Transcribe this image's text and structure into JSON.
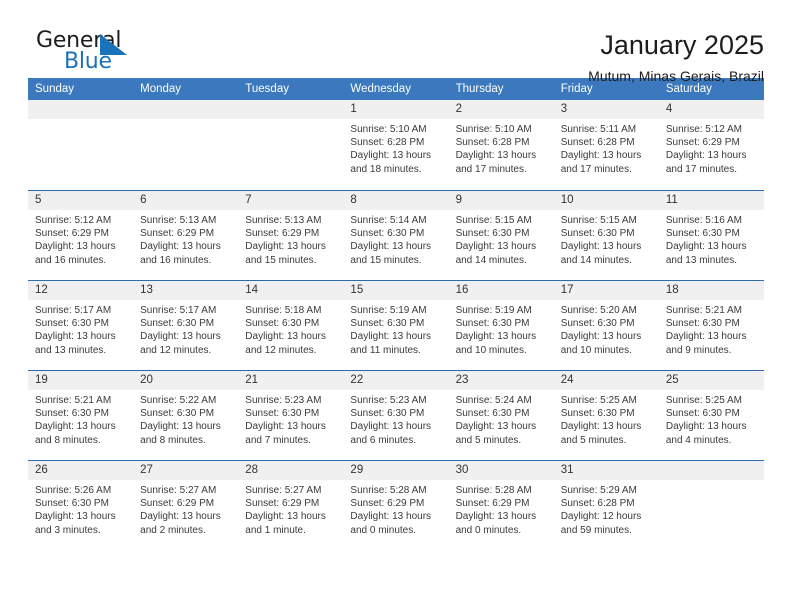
{
  "brand": {
    "name_part1": "General",
    "name_part2": "Blue",
    "flag_color": "#1a72ba"
  },
  "header": {
    "title": "January 2025",
    "location": "Mutum, Minas Gerais, Brazil"
  },
  "theme": {
    "header_blue": "#3b78bd",
    "row_divider": "#2f6bab",
    "day_band": "#f0f0f0"
  },
  "weekdays": [
    "Sunday",
    "Monday",
    "Tuesday",
    "Wednesday",
    "Thursday",
    "Friday",
    "Saturday"
  ],
  "weeks": [
    [
      {
        "day": "",
        "empty": true,
        "sunrise": "",
        "sunset": "",
        "daylight_line1": "",
        "daylight_line2": ""
      },
      {
        "day": "",
        "empty": true,
        "sunrise": "",
        "sunset": "",
        "daylight_line1": "",
        "daylight_line2": ""
      },
      {
        "day": "",
        "empty": true,
        "sunrise": "",
        "sunset": "",
        "daylight_line1": "",
        "daylight_line2": ""
      },
      {
        "day": "1",
        "empty": false,
        "sunrise": "Sunrise: 5:10 AM",
        "sunset": "Sunset: 6:28 PM",
        "daylight_line1": "Daylight: 13 hours",
        "daylight_line2": "and 18 minutes."
      },
      {
        "day": "2",
        "empty": false,
        "sunrise": "Sunrise: 5:10 AM",
        "sunset": "Sunset: 6:28 PM",
        "daylight_line1": "Daylight: 13 hours",
        "daylight_line2": "and 17 minutes."
      },
      {
        "day": "3",
        "empty": false,
        "sunrise": "Sunrise: 5:11 AM",
        "sunset": "Sunset: 6:28 PM",
        "daylight_line1": "Daylight: 13 hours",
        "daylight_line2": "and 17 minutes."
      },
      {
        "day": "4",
        "empty": false,
        "sunrise": "Sunrise: 5:12 AM",
        "sunset": "Sunset: 6:29 PM",
        "daylight_line1": "Daylight: 13 hours",
        "daylight_line2": "and 17 minutes."
      }
    ],
    [
      {
        "day": "5",
        "empty": false,
        "sunrise": "Sunrise: 5:12 AM",
        "sunset": "Sunset: 6:29 PM",
        "daylight_line1": "Daylight: 13 hours",
        "daylight_line2": "and 16 minutes."
      },
      {
        "day": "6",
        "empty": false,
        "sunrise": "Sunrise: 5:13 AM",
        "sunset": "Sunset: 6:29 PM",
        "daylight_line1": "Daylight: 13 hours",
        "daylight_line2": "and 16 minutes."
      },
      {
        "day": "7",
        "empty": false,
        "sunrise": "Sunrise: 5:13 AM",
        "sunset": "Sunset: 6:29 PM",
        "daylight_line1": "Daylight: 13 hours",
        "daylight_line2": "and 15 minutes."
      },
      {
        "day": "8",
        "empty": false,
        "sunrise": "Sunrise: 5:14 AM",
        "sunset": "Sunset: 6:30 PM",
        "daylight_line1": "Daylight: 13 hours",
        "daylight_line2": "and 15 minutes."
      },
      {
        "day": "9",
        "empty": false,
        "sunrise": "Sunrise: 5:15 AM",
        "sunset": "Sunset: 6:30 PM",
        "daylight_line1": "Daylight: 13 hours",
        "daylight_line2": "and 14 minutes."
      },
      {
        "day": "10",
        "empty": false,
        "sunrise": "Sunrise: 5:15 AM",
        "sunset": "Sunset: 6:30 PM",
        "daylight_line1": "Daylight: 13 hours",
        "daylight_line2": "and 14 minutes."
      },
      {
        "day": "11",
        "empty": false,
        "sunrise": "Sunrise: 5:16 AM",
        "sunset": "Sunset: 6:30 PM",
        "daylight_line1": "Daylight: 13 hours",
        "daylight_line2": "and 13 minutes."
      }
    ],
    [
      {
        "day": "12",
        "empty": false,
        "sunrise": "Sunrise: 5:17 AM",
        "sunset": "Sunset: 6:30 PM",
        "daylight_line1": "Daylight: 13 hours",
        "daylight_line2": "and 13 minutes."
      },
      {
        "day": "13",
        "empty": false,
        "sunrise": "Sunrise: 5:17 AM",
        "sunset": "Sunset: 6:30 PM",
        "daylight_line1": "Daylight: 13 hours",
        "daylight_line2": "and 12 minutes."
      },
      {
        "day": "14",
        "empty": false,
        "sunrise": "Sunrise: 5:18 AM",
        "sunset": "Sunset: 6:30 PM",
        "daylight_line1": "Daylight: 13 hours",
        "daylight_line2": "and 12 minutes."
      },
      {
        "day": "15",
        "empty": false,
        "sunrise": "Sunrise: 5:19 AM",
        "sunset": "Sunset: 6:30 PM",
        "daylight_line1": "Daylight: 13 hours",
        "daylight_line2": "and 11 minutes."
      },
      {
        "day": "16",
        "empty": false,
        "sunrise": "Sunrise: 5:19 AM",
        "sunset": "Sunset: 6:30 PM",
        "daylight_line1": "Daylight: 13 hours",
        "daylight_line2": "and 10 minutes."
      },
      {
        "day": "17",
        "empty": false,
        "sunrise": "Sunrise: 5:20 AM",
        "sunset": "Sunset: 6:30 PM",
        "daylight_line1": "Daylight: 13 hours",
        "daylight_line2": "and 10 minutes."
      },
      {
        "day": "18",
        "empty": false,
        "sunrise": "Sunrise: 5:21 AM",
        "sunset": "Sunset: 6:30 PM",
        "daylight_line1": "Daylight: 13 hours",
        "daylight_line2": "and 9 minutes."
      }
    ],
    [
      {
        "day": "19",
        "empty": false,
        "sunrise": "Sunrise: 5:21 AM",
        "sunset": "Sunset: 6:30 PM",
        "daylight_line1": "Daylight: 13 hours",
        "daylight_line2": "and 8 minutes."
      },
      {
        "day": "20",
        "empty": false,
        "sunrise": "Sunrise: 5:22 AM",
        "sunset": "Sunset: 6:30 PM",
        "daylight_line1": "Daylight: 13 hours",
        "daylight_line2": "and 8 minutes."
      },
      {
        "day": "21",
        "empty": false,
        "sunrise": "Sunrise: 5:23 AM",
        "sunset": "Sunset: 6:30 PM",
        "daylight_line1": "Daylight: 13 hours",
        "daylight_line2": "and 7 minutes."
      },
      {
        "day": "22",
        "empty": false,
        "sunrise": "Sunrise: 5:23 AM",
        "sunset": "Sunset: 6:30 PM",
        "daylight_line1": "Daylight: 13 hours",
        "daylight_line2": "and 6 minutes."
      },
      {
        "day": "23",
        "empty": false,
        "sunrise": "Sunrise: 5:24 AM",
        "sunset": "Sunset: 6:30 PM",
        "daylight_line1": "Daylight: 13 hours",
        "daylight_line2": "and 5 minutes."
      },
      {
        "day": "24",
        "empty": false,
        "sunrise": "Sunrise: 5:25 AM",
        "sunset": "Sunset: 6:30 PM",
        "daylight_line1": "Daylight: 13 hours",
        "daylight_line2": "and 5 minutes."
      },
      {
        "day": "25",
        "empty": false,
        "sunrise": "Sunrise: 5:25 AM",
        "sunset": "Sunset: 6:30 PM",
        "daylight_line1": "Daylight: 13 hours",
        "daylight_line2": "and 4 minutes."
      }
    ],
    [
      {
        "day": "26",
        "empty": false,
        "sunrise": "Sunrise: 5:26 AM",
        "sunset": "Sunset: 6:30 PM",
        "daylight_line1": "Daylight: 13 hours",
        "daylight_line2": "and 3 minutes."
      },
      {
        "day": "27",
        "empty": false,
        "sunrise": "Sunrise: 5:27 AM",
        "sunset": "Sunset: 6:29 PM",
        "daylight_line1": "Daylight: 13 hours",
        "daylight_line2": "and 2 minutes."
      },
      {
        "day": "28",
        "empty": false,
        "sunrise": "Sunrise: 5:27 AM",
        "sunset": "Sunset: 6:29 PM",
        "daylight_line1": "Daylight: 13 hours",
        "daylight_line2": "and 1 minute."
      },
      {
        "day": "29",
        "empty": false,
        "sunrise": "Sunrise: 5:28 AM",
        "sunset": "Sunset: 6:29 PM",
        "daylight_line1": "Daylight: 13 hours",
        "daylight_line2": "and 0 minutes."
      },
      {
        "day": "30",
        "empty": false,
        "sunrise": "Sunrise: 5:28 AM",
        "sunset": "Sunset: 6:29 PM",
        "daylight_line1": "Daylight: 13 hours",
        "daylight_line2": "and 0 minutes."
      },
      {
        "day": "31",
        "empty": false,
        "sunrise": "Sunrise: 5:29 AM",
        "sunset": "Sunset: 6:28 PM",
        "daylight_line1": "Daylight: 12 hours",
        "daylight_line2": "and 59 minutes."
      },
      {
        "day": "",
        "empty": true,
        "sunrise": "",
        "sunset": "",
        "daylight_line1": "",
        "daylight_line2": ""
      }
    ]
  ]
}
